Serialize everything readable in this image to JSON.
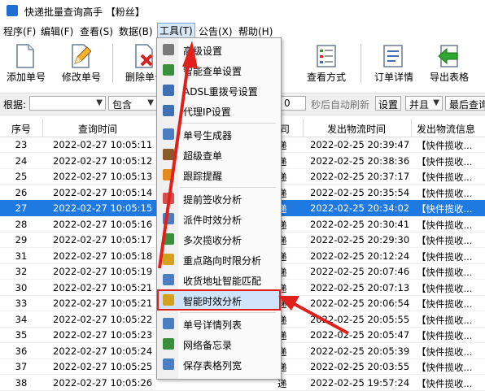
{
  "window": {
    "title": "快递批量查询高手 【粉丝】"
  },
  "menubar": {
    "items": [
      "程序(F)",
      "编辑(F)",
      "查看(S)",
      "数据(B)",
      "工具(T)",
      "公告(X)",
      "帮助(H)"
    ]
  },
  "toolbar": {
    "add_label": "添加单号",
    "edit_label": "修改单号",
    "delete_label": "删除单号",
    "view_label": "查看方式",
    "detail_label": "订单详情",
    "export_label": "导出表格"
  },
  "filterbar": {
    "basis_label": "根据:",
    "basis_value": "",
    "match_value": "包含",
    "seconds_value": "0",
    "auto_refresh_label": "秒后自动刷新",
    "settings_label": "设置",
    "logic_value": "并且",
    "last_query_value": "最后查询"
  },
  "grid": {
    "columns": [
      "序号",
      "查询时间",
      "司",
      "发出物流时间",
      "发出物流信息"
    ],
    "rows": [
      {
        "no": "23",
        "query": "2022-02-27  10:05:11",
        "co": "递",
        "sent": "2022-02-25  20:39:47",
        "info": "【快件揽收..."
      },
      {
        "no": "24",
        "query": "2022-02-27  10:05:12",
        "co": "递",
        "sent": "2022-02-25  20:38:36",
        "info": "【快件揽收..."
      },
      {
        "no": "25",
        "query": "2022-02-27  10:05:13",
        "co": "递",
        "sent": "2022-02-25  20:37:17",
        "info": "【快件揽收..."
      },
      {
        "no": "26",
        "query": "2022-02-27  10:05:14",
        "co": "递",
        "sent": "2022-02-25  20:35:54",
        "info": "【快件揽收..."
      },
      {
        "no": "27",
        "query": "2022-02-27  10:05:15",
        "co": "递",
        "sent": "2022-02-25  20:34:02",
        "info": "【快件揽收..."
      },
      {
        "no": "28",
        "query": "2022-02-27  10:05:16",
        "co": "递",
        "sent": "2022-02-25  20:30:41",
        "info": "【快件揽收..."
      },
      {
        "no": "29",
        "query": "2022-02-27  10:05:17",
        "co": "递",
        "sent": "2022-02-25  20:29:30",
        "info": "【快件揽收..."
      },
      {
        "no": "31",
        "query": "2022-02-27  10:05:18",
        "co": "递",
        "sent": "2022-02-25  20:12:24",
        "info": "【快件揽收..."
      },
      {
        "no": "32",
        "query": "2022-02-27  10:05:19",
        "co": "递",
        "sent": "2022-02-25  20:07:46",
        "info": "【快件揽收..."
      },
      {
        "no": "30",
        "query": "2022-02-27  10:05:21",
        "co": "递",
        "sent": "2022-02-25  20:07:13",
        "info": "【快件揽收..."
      },
      {
        "no": "33",
        "query": "2022-02-27  10:05:21",
        "co": "递",
        "sent": "2022-02-25  20:06:54",
        "info": "【快件揽收..."
      },
      {
        "no": "34",
        "query": "2022-02-27  10:05:22",
        "co": "递",
        "sent": "2022-02-25  20:05:55",
        "info": "【快件揽收..."
      },
      {
        "no": "35",
        "query": "2022-02-27  10:05:23",
        "co": "递",
        "sent": "2022-02-25  20:05:47",
        "info": "【快件揽收..."
      },
      {
        "no": "36",
        "query": "2022-02-27  10:05:24",
        "co": "递",
        "sent": "2022-02-25  20:05:39",
        "info": "【快件揽收..."
      },
      {
        "no": "37",
        "query": "2022-02-27  10:05:25",
        "co": "递",
        "sent": "2022-02-25  20:03:55",
        "info": "【快件揽收..."
      },
      {
        "no": "38",
        "query": "2022-02-27  10:05:26",
        "co": "递",
        "sent": "2022-02-25  19:57:24",
        "info": "【快件揽收..."
      }
    ],
    "selected_row": "27"
  },
  "tools_menu": {
    "items": [
      {
        "label": "高级设置",
        "icon": "gear-icon",
        "color": "#7a7a7a"
      },
      {
        "label": "智能查单设置",
        "icon": "smart-query-icon",
        "color": "#3a8f3a"
      },
      {
        "label": "ADSL重拨号设置",
        "icon": "monitor-icon",
        "color": "#3f6fb5"
      },
      {
        "label": "代理IP设置",
        "icon": "monitor-icon",
        "color": "#3f6fb5"
      },
      {
        "label": "单号生成器",
        "icon": "truck-icon",
        "color": "#4a7ec0"
      },
      {
        "label": "超级查单",
        "icon": "search-icon",
        "color": "#8a5a2a"
      },
      {
        "label": "跟踪提醒",
        "icon": "alarm-icon",
        "color": "#e58a1f"
      },
      {
        "label": "提前签收分析",
        "icon": "bars-icon",
        "color": "#d45050"
      },
      {
        "label": "派件时效分析",
        "icon": "bar-chart-icon",
        "color": "#4a7ec0"
      },
      {
        "label": "多次揽收分析",
        "icon": "line-chart-icon",
        "color": "#3a8f3a"
      },
      {
        "label": "重点路向时限分析",
        "icon": "route-chart-icon",
        "color": "#d4a020"
      },
      {
        "label": "收货地址智能匹配",
        "icon": "address-icon",
        "color": "#4a7ec0"
      },
      {
        "label": "智能时效分析",
        "icon": "timing-chart-icon",
        "color": "#d4a020"
      },
      {
        "label": "单号详情列表",
        "icon": "list-icon",
        "color": "#4a7ec0"
      },
      {
        "label": "网络备忘录",
        "icon": "memo-icon",
        "color": "#3a8f3a"
      },
      {
        "label": "保存表格列宽",
        "icon": "table-icon",
        "color": "#4a7ec0"
      }
    ],
    "highlighted": "智能时效分析"
  }
}
